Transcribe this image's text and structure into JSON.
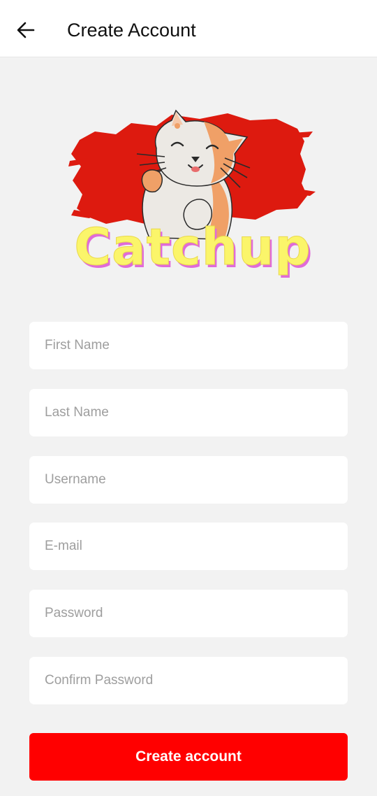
{
  "header": {
    "title": "Create Account",
    "back_icon": "arrow-left-icon"
  },
  "logo": {
    "text": "Catchup",
    "colors": {
      "brush": "#dd1a0f",
      "text": "#fbf56a",
      "text_shadow": "#e06bd8",
      "cat_fur": "#f0a067",
      "cat_light": "#ece9e4"
    }
  },
  "form": {
    "fields": [
      {
        "name": "first-name-field",
        "placeholder": "First Name",
        "value": ""
      },
      {
        "name": "last-name-field",
        "placeholder": "Last Name",
        "value": ""
      },
      {
        "name": "username-field",
        "placeholder": "Username",
        "value": ""
      },
      {
        "name": "email-field",
        "placeholder": "E-mail",
        "value": ""
      },
      {
        "name": "password-field",
        "placeholder": "Password",
        "value": ""
      },
      {
        "name": "confirm-password-field",
        "placeholder": "Confirm Password",
        "value": ""
      }
    ],
    "submit_label": "Create account"
  },
  "colors": {
    "accent": "#ff0000",
    "background": "#f2f2f2",
    "field_background": "#ffffff",
    "placeholder": "#9e9e9e"
  }
}
